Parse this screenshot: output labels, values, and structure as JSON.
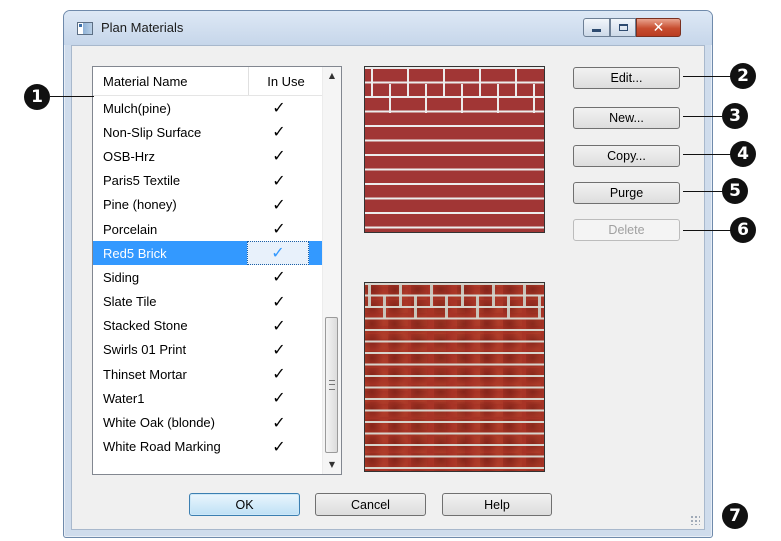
{
  "window": {
    "title": "Plan Materials"
  },
  "list": {
    "headers": {
      "name": "Material Name",
      "in_use": "In Use"
    },
    "rows": [
      {
        "name": "Mulch(pine)",
        "in_use": "✓"
      },
      {
        "name": "Non-Slip Surface",
        "in_use": "✓"
      },
      {
        "name": "OSB-Hrz",
        "in_use": "✓"
      },
      {
        "name": "Paris5 Textile",
        "in_use": "✓"
      },
      {
        "name": "Pine (honey)",
        "in_use": "✓"
      },
      {
        "name": "Porcelain",
        "in_use": "✓"
      },
      {
        "name": "Red5 Brick",
        "in_use": "✓",
        "selected": true
      },
      {
        "name": "Siding",
        "in_use": "✓"
      },
      {
        "name": "Slate Tile",
        "in_use": "✓"
      },
      {
        "name": "Stacked Stone",
        "in_use": "✓"
      },
      {
        "name": "Swirls 01 Print",
        "in_use": "✓"
      },
      {
        "name": "Thinset Mortar",
        "in_use": "✓"
      },
      {
        "name": "Water1",
        "in_use": "✓"
      },
      {
        "name": "White Oak (blonde)",
        "in_use": "✓"
      },
      {
        "name": "White Road Marking",
        "in_use": "✓"
      }
    ]
  },
  "buttons": {
    "edit": "Edit...",
    "new": "New...",
    "copy": "Copy...",
    "purge": "Purge",
    "delete": "Delete",
    "ok": "OK",
    "cancel": "Cancel",
    "help": "Help"
  },
  "callouts": [
    "1",
    "2",
    "3",
    "4",
    "5",
    "6",
    "7"
  ],
  "icons": {
    "app": "app-window-icon",
    "minimize": "minimize-icon",
    "maximize": "maximize-icon",
    "close": "close-icon",
    "check": "checkmark-icon",
    "scroll_up": "scroll-up-arrow-icon",
    "scroll_down": "scroll-down-arrow-icon",
    "resize": "resize-grip-icon"
  },
  "colors": {
    "selection": "#3399ff",
    "brick_flat": "#a13635",
    "brick_photo": "#a83426",
    "close_button": "#c74d2f",
    "callout": "#111111"
  }
}
